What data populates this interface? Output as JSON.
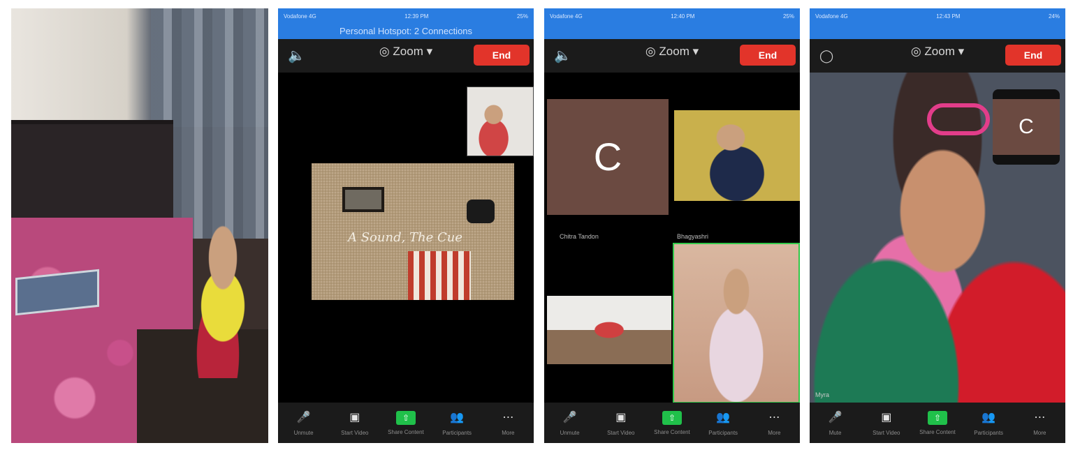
{
  "panel2": {
    "status_carrier": "Vodafone 4G",
    "status_time": "12:39 PM",
    "status_battery": "25%",
    "hotspot_text": "Personal Hotspot: 2 Connections",
    "app_title": "Zoom",
    "end_label": "End",
    "shared_caption": "A Sound, The Cue",
    "toolbar": [
      {
        "icon": "mic-muted-icon",
        "label": "Unmute"
      },
      {
        "icon": "video-off-icon",
        "label": "Start Video"
      },
      {
        "icon": "share-icon",
        "label": "Share Content"
      },
      {
        "icon": "participants-icon",
        "label": "Participants"
      },
      {
        "icon": "more-icon",
        "label": "More"
      }
    ]
  },
  "panel3": {
    "status_carrier": "Vodafone 4G",
    "status_time": "12:40 PM",
    "status_battery": "25%",
    "app_title": "Zoom",
    "end_label": "End",
    "avatar_letter": "C",
    "tile_names": [
      "Chitra Tandon",
      "Bhagyashri"
    ],
    "toolbar": [
      {
        "icon": "mic-muted-icon",
        "label": "Unmute"
      },
      {
        "icon": "video-off-icon",
        "label": "Start Video"
      },
      {
        "icon": "share-icon",
        "label": "Share Content"
      },
      {
        "icon": "participants-icon",
        "label": "Participants"
      },
      {
        "icon": "more-icon",
        "label": "More"
      }
    ]
  },
  "panel4": {
    "status_carrier": "Vodafone 4G",
    "status_time": "12:43 PM",
    "status_battery": "24%",
    "app_title": "Zoom",
    "end_label": "End",
    "selfview_letter": "C",
    "active_speaker_name": "Myra",
    "toolbar": [
      {
        "icon": "mic-icon",
        "label": "Mute"
      },
      {
        "icon": "video-off-icon",
        "label": "Start Video"
      },
      {
        "icon": "share-icon",
        "label": "Share Content"
      },
      {
        "icon": "participants-icon",
        "label": "Participants"
      },
      {
        "icon": "more-icon",
        "label": "More"
      }
    ]
  },
  "colors": {
    "end_button": "#e2342a",
    "share_green": "#20c04a",
    "status_blue": "#2a7de1",
    "avatar_brown": "#6b4a41"
  }
}
